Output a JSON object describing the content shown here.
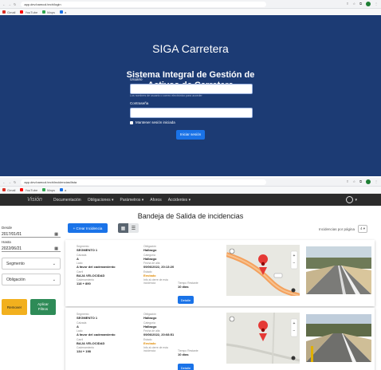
{
  "login_window": {
    "url": "app.dev.bamcol.tech/login",
    "bookmarks": [
      {
        "label": "Gmail",
        "color": "#d93025"
      },
      {
        "label": "YouTube",
        "color": "#ff0000"
      },
      {
        "label": "Maps",
        "color": "#34a853"
      },
      {
        "label": "a",
        "color": "#1a73e8"
      }
    ],
    "title": "SIGA Carretera",
    "subtitle_line1": "Sistema Integral de Gestión de",
    "subtitle_line2": "Activos de Carretera",
    "user_label": "Usuario",
    "user_hint": "Los nombres de usuario o correo electrónico para acceder",
    "password_label": "Contraseña",
    "remember_label": "Mantener sesión iniciada",
    "login_button": "Iniciar sesión"
  },
  "app_window": {
    "url": "app.dev.bamcol.tech/incidencias/lista",
    "bookmarks": [
      {
        "label": "Gmail",
        "color": "#d93025"
      },
      {
        "label": "YouTube",
        "color": "#ff0000"
      },
      {
        "label": "Maps",
        "color": "#34a853"
      },
      {
        "label": "a",
        "color": "#1a73e8"
      }
    ],
    "nav": {
      "logo": "Visión",
      "items": [
        "Documentación",
        "Obligaciones ▾",
        "Parámetros ▾",
        "Aforos",
        "Accidentes ▾"
      ]
    },
    "page_title": "Bandeja de Salida de incidencias",
    "filters": {
      "from_label": "Desde",
      "from_value": "2017/01/01",
      "to_label": "Hasta",
      "to_value": "2022/06/21",
      "segment": "Segmento",
      "obligation": "Obligación",
      "clear_button": "Remover",
      "apply_button_line1": "Aplicar",
      "apply_button_line2": "Filtros"
    },
    "create_button": "+ Crear Incidencia",
    "per_page_label": "Incidencias por página",
    "per_page_value": "4 ▾",
    "incidents": [
      {
        "segment_label": "Segmento",
        "segment": "SEGMENTO 1",
        "calzada_label": "Calzada",
        "calzada": "A",
        "lado_label": "Lado",
        "lado": "A favor del cadenamiento",
        "carril_label": "Carril",
        "carril": "BAJA VELOCIDAD",
        "cad_label": "Cadenamiento",
        "cad": "118 + 890",
        "ob_label": "Obligación",
        "ob": "Hallazgo",
        "cat_label": "Categoría",
        "cat": "Hallazgo",
        "fecha_label": "Fecha de alta",
        "fecha": "09/06/2022, 20:13:20",
        "estado_label": "Estado",
        "estado": "Enviado",
        "plazo_label": "Tiempo Restante",
        "plazo": "10 días",
        "cierre_label": "Info al cierre de esta incidencia",
        "detail_button": "Detalle"
      },
      {
        "segment_label": "Segmento",
        "segment": "SEGMENTO 1",
        "calzada_label": "Calzada",
        "calzada": "A",
        "lado_label": "Lado",
        "lado": "A favor del cadenamiento",
        "carril_label": "Carril",
        "carril": "BAJA VELOCIDAD",
        "cad_label": "Cadenamiento",
        "cad": "134 + 198",
        "ob_label": "Obligación",
        "ob": "Hallazgo",
        "cat_label": "Categoría",
        "cat": "Hallazgo",
        "fecha_label": "Fecha de alta",
        "fecha": "09/06/2022, 20:08:51",
        "estado_label": "Estado",
        "estado": "Enviado",
        "plazo_label": "Tiempo Restante",
        "plazo": "10 días",
        "cierre_label": "Info al cierre de esta incidencia",
        "detail_button": "Detalle"
      }
    ]
  }
}
